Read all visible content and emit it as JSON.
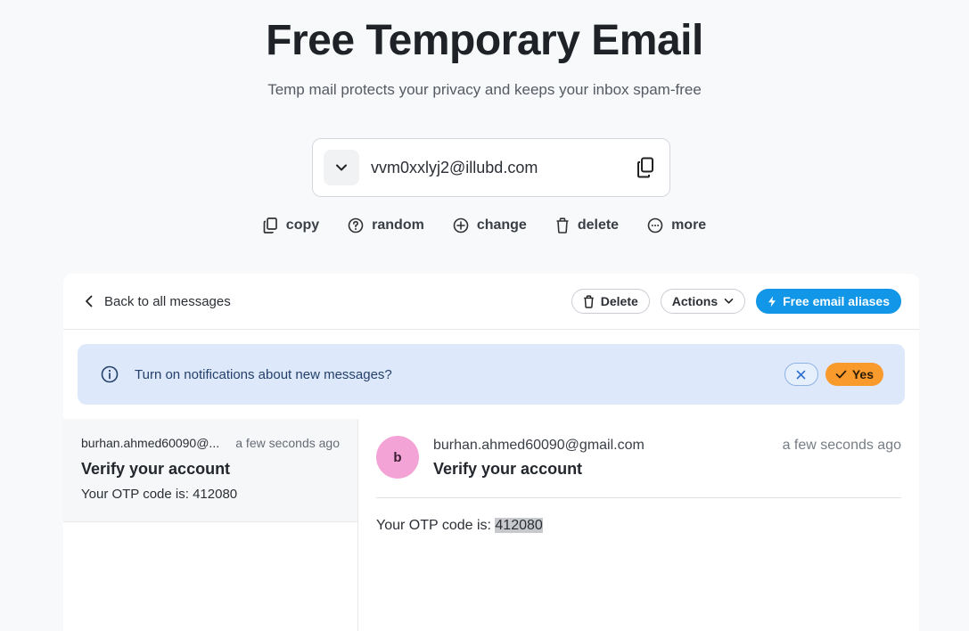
{
  "hero": {
    "title": "Free Temporary Email",
    "subtitle": "Temp mail protects your privacy and keeps your inbox spam-free"
  },
  "mailbox": {
    "address": "vvm0xxlyj2@illubd.com"
  },
  "actions": {
    "copy": "copy",
    "random": "random",
    "change": "change",
    "delete": "delete",
    "more": "more"
  },
  "header": {
    "back_label": "Back to all messages",
    "delete_label": "Delete",
    "actions_label": "Actions",
    "aliases_label": "Free email aliases"
  },
  "notice": {
    "text": "Turn on notifications about new messages?",
    "yes_label": "Yes"
  },
  "list": {
    "items": [
      {
        "from": "burhan.ahmed60090@...",
        "time": "a few seconds ago",
        "subject": "Verify your account",
        "preview": "Your OTP code is: 412080"
      }
    ]
  },
  "reader": {
    "avatar_letter": "b",
    "from": "burhan.ahmed60090@gmail.com",
    "subject": "Verify your account",
    "time": "a few seconds ago",
    "body_prefix": "Your OTP code is: ",
    "otp": "412080"
  },
  "colors": {
    "accent_blue": "#1296e8",
    "yes_orange": "#f99a2d",
    "avatar_pink": "#f4a3d6",
    "notice_bg": "#dde9fb"
  }
}
